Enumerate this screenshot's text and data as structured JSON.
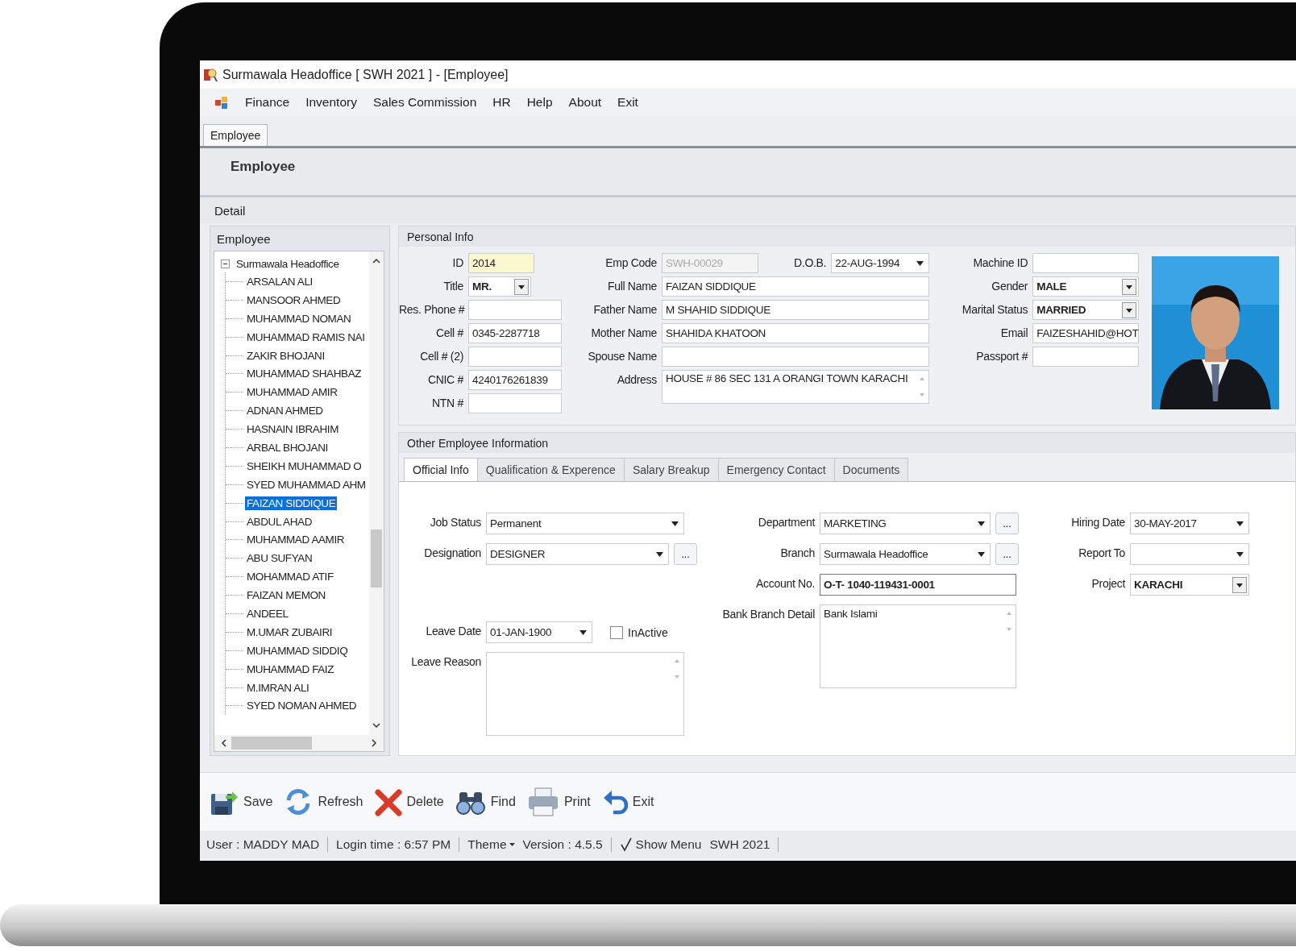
{
  "window": {
    "title": "Surmawala Headoffice [ SWH 2021 ]  - [Employee]"
  },
  "menu": [
    "Finance",
    "Inventory",
    "Sales Commission",
    "HR",
    "Help",
    "About",
    "Exit"
  ],
  "doc_tabs": [
    {
      "label": "Employee",
      "selected": true
    }
  ],
  "header": {
    "title": "Employee"
  },
  "section": {
    "title": "Detail"
  },
  "employee_panel": {
    "title": "Employee",
    "tree": {
      "label": "Surmawala Headoffice",
      "expanded": true,
      "children": [
        {
          "label": "ARSALAN ALI",
          "selected": false
        },
        {
          "label": "MANSOOR AHMED",
          "selected": false
        },
        {
          "label": "MUHAMMAD NOMAN",
          "selected": false
        },
        {
          "label": "MUHAMMAD RAMIS NAI",
          "selected": false
        },
        {
          "label": "ZAKIR BHOJANI",
          "selected": false
        },
        {
          "label": "MUHAMMAD SHAHBAZ",
          "selected": false
        },
        {
          "label": "MUHAMMAD AMIR",
          "selected": false
        },
        {
          "label": "ADNAN AHMED",
          "selected": false
        },
        {
          "label": "HASNAIN IBRAHIM",
          "selected": false
        },
        {
          "label": "ARBAL BHOJANI",
          "selected": false
        },
        {
          "label": "SHEIKH MUHAMMAD O",
          "selected": false
        },
        {
          "label": "SYED MUHAMMAD AHM",
          "selected": false
        },
        {
          "label": "FAIZAN SIDDIQUE",
          "selected": true
        },
        {
          "label": "ABDUL AHAD",
          "selected": false
        },
        {
          "label": "MUHAMMAD AAMIR",
          "selected": false
        },
        {
          "label": "ABU SUFYAN",
          "selected": false
        },
        {
          "label": "MOHAMMAD ATIF",
          "selected": false
        },
        {
          "label": "FAIZAN MEMON",
          "selected": false
        },
        {
          "label": "ANDEEL",
          "selected": false
        },
        {
          "label": "M.UMAR ZUBAIRI",
          "selected": false
        },
        {
          "label": "MUHAMMAD SIDDIQ",
          "selected": false
        },
        {
          "label": "MUHAMMAD FAIZ",
          "selected": false
        },
        {
          "label": "M.IMRAN ALI",
          "selected": false
        },
        {
          "label": "SYED NOMAN AHMED",
          "selected": false
        }
      ]
    }
  },
  "personal_info": {
    "title": "Personal Info",
    "columns": [
      {
        "fields": [
          {
            "label": "ID",
            "value": "2014",
            "kind": "highlight"
          },
          {
            "label": "Title",
            "value": "MR.",
            "kind": "combo"
          },
          {
            "label": "Res. Phone #",
            "kind": "text"
          },
          {
            "label": "Cell #",
            "value": "0345-2287718",
            "kind": "text"
          },
          {
            "label": "Cell # (2)",
            "kind": "text"
          },
          {
            "label": "CNIC #",
            "value": "4240176261839",
            "kind": "text"
          },
          {
            "label": "NTN #",
            "kind": "text"
          }
        ]
      },
      {
        "fields": [
          {
            "label": "Emp Code",
            "value": "SWH-00029",
            "kind": "readonly",
            "beside": {
              "label": "D.O.B.",
              "value": "22-AUG-1994",
              "kind": "select"
            }
          },
          {
            "label": "Full Name",
            "value": "FAIZAN SIDDIQUE",
            "kind": "text"
          },
          {
            "label": "Father Name",
            "value": "M SHAHID SIDDIQUE",
            "kind": "text"
          },
          {
            "label": "Mother Name",
            "value": "SHAHIDA KHATOON",
            "kind": "text"
          },
          {
            "label": "Spouse Name",
            "kind": "text"
          },
          {
            "label": "Address",
            "value": "HOUSE # 86 SEC 131 A ORANGI TOWN KARACHI",
            "kind": "multiline"
          }
        ]
      },
      {
        "fields": [
          {
            "label": "Machine ID",
            "kind": "text"
          },
          {
            "label": "Gender",
            "value": "MALE",
            "kind": "combo"
          },
          {
            "label": "Marital Status",
            "value": "MARRIED",
            "kind": "combo"
          },
          {
            "label": "Email",
            "value": "FAIZESHAHID@HOT",
            "kind": "text"
          },
          {
            "label": "Passport #",
            "kind": "text"
          }
        ]
      }
    ]
  },
  "other_info": {
    "title": "Other Employee Information",
    "tabs": [
      {
        "label": "Official Info",
        "selected": true
      },
      {
        "label": "Qualification & Experence",
        "selected": false
      },
      {
        "label": "Salary Breakup",
        "selected": false
      },
      {
        "label": "Emergency Contact",
        "selected": false
      },
      {
        "label": "Documents",
        "selected": false
      }
    ],
    "columns": [
      {
        "fields": [
          {
            "label": "Job Status",
            "value": "Permanent",
            "kind": "select"
          },
          {
            "label": "Designation",
            "value": "DESIGNER",
            "kind": "select",
            "button": "..."
          },
          {
            "label": "Leave Date",
            "value": "01-JAN-1900",
            "kind": "select",
            "checkbox": {
              "label": "InActive",
              "checked": false
            }
          },
          {
            "label": "Leave Reason",
            "kind": "multiline"
          }
        ]
      },
      {
        "fields": [
          {
            "label": "Department",
            "value": "MARKETING",
            "kind": "select",
            "button": "..."
          },
          {
            "label": "Branch",
            "value": "Surmawala Headoffice",
            "kind": "select",
            "button": "..."
          },
          {
            "label": "Account No.",
            "value": "O-T- 1040-119431-0001",
            "kind": "emphasized"
          },
          {
            "label": "Bank Branch Detail",
            "value": "Bank Islami",
            "kind": "multiline"
          }
        ]
      },
      {
        "fields": [
          {
            "label": "Hiring Date",
            "value": "30-MAY-2017",
            "kind": "select"
          },
          {
            "label": "Report To",
            "kind": "select"
          },
          {
            "label": "Project",
            "value": "KARACHI",
            "kind": "combo"
          }
        ]
      }
    ]
  },
  "toolbar": [
    {
      "label": "Save",
      "kind": "save"
    },
    {
      "label": "Refresh",
      "kind": "refresh"
    },
    {
      "label": "Delete",
      "kind": "delete"
    },
    {
      "label": "Find",
      "kind": "find"
    },
    {
      "label": "Print",
      "kind": "print"
    },
    {
      "label": "Exit",
      "kind": "exit"
    }
  ],
  "status_bar": {
    "user": "User : MADDY MAD",
    "login": "Login time : 6:57 PM",
    "theme": "Theme",
    "version": "Version : 4.5.5",
    "show_menu": {
      "label": "Show Menu",
      "checked": true
    },
    "company": "SWH 2021"
  }
}
